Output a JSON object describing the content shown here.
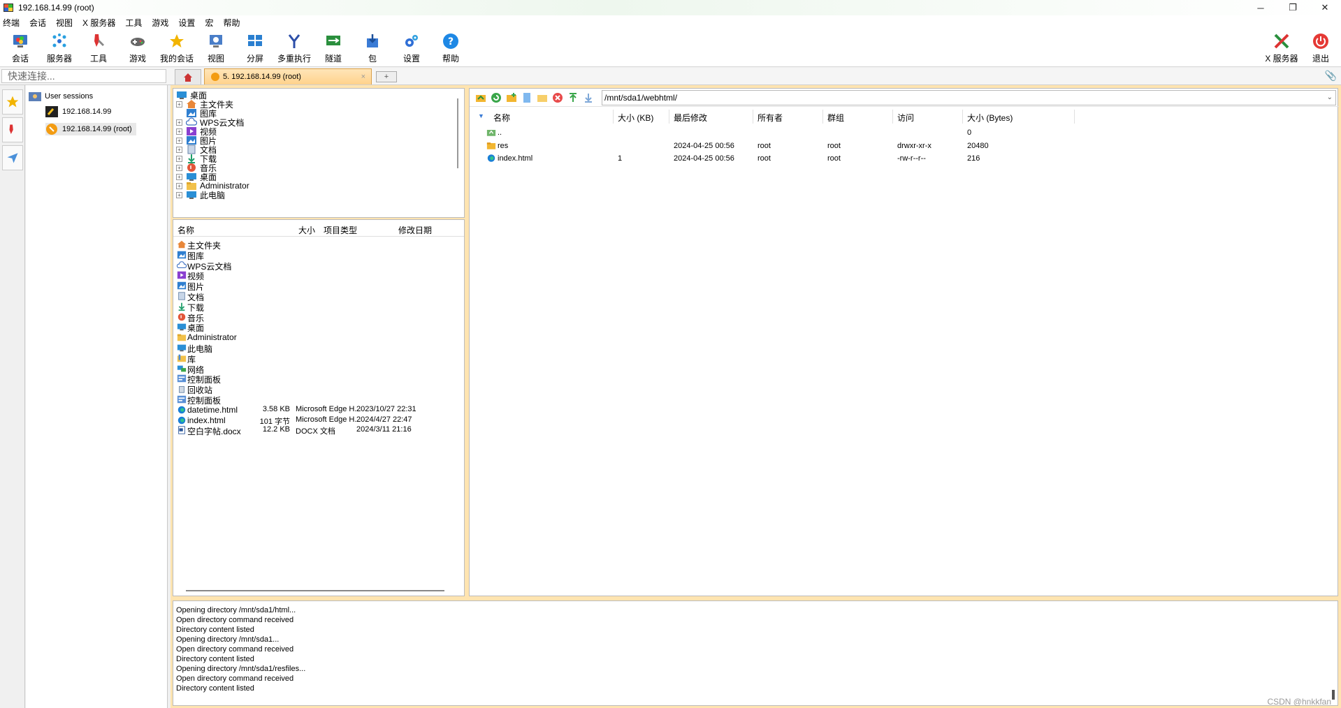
{
  "window": {
    "title": "192.168.14.99 (root)",
    "controls": [
      "─",
      "❐",
      "✕"
    ]
  },
  "menu": [
    "终端",
    "会话",
    "视图",
    "X 服务器",
    "工具",
    "游戏",
    "设置",
    "宏",
    "帮助"
  ],
  "toolbar": {
    "session": "会话",
    "servers": "服务器",
    "tools": "工具",
    "games": "游戏",
    "my_sessions": "我的会话",
    "view": "视图",
    "split": "分屏",
    "multiexec": "多重执行",
    "tunnel": "隧道",
    "packages": "包",
    "settings": "设置",
    "help": "帮助",
    "xserver": "X 服务器",
    "exit": "退出"
  },
  "quick_connect": {
    "placeholder": "快速连接..."
  },
  "tabs": {
    "active": "5. 192.168.14.99 (root)",
    "close": "×",
    "add": "+"
  },
  "sessions": {
    "root": "User sessions",
    "items": [
      "192.168.14.99",
      "192.168.14.99 (root)"
    ]
  },
  "local_tree": [
    {
      "label": "桌面",
      "pm": ""
    },
    {
      "label": "主文件夹",
      "pm": "+"
    },
    {
      "label": "图库",
      "pm": ""
    },
    {
      "label": "WPS云文档",
      "pm": "+"
    },
    {
      "label": "视频",
      "pm": "+"
    },
    {
      "label": "图片",
      "pm": "+"
    },
    {
      "label": "文档",
      "pm": "+"
    },
    {
      "label": "下载",
      "pm": "+"
    },
    {
      "label": "音乐",
      "pm": "+"
    },
    {
      "label": "桌面",
      "pm": "+"
    },
    {
      "label": "Administrator",
      "pm": "+"
    },
    {
      "label": "此电脑",
      "pm": "+"
    }
  ],
  "local_list": {
    "headers": {
      "name": "名称",
      "size": "大小",
      "type": "项目类型",
      "date": "修改日期"
    },
    "rows": [
      {
        "name": "主文件夹",
        "size": "",
        "type": "",
        "date": ""
      },
      {
        "name": "图库",
        "size": "",
        "type": "",
        "date": ""
      },
      {
        "name": "WPS云文档",
        "size": "",
        "type": "",
        "date": ""
      },
      {
        "name": "视频",
        "size": "",
        "type": "",
        "date": ""
      },
      {
        "name": "图片",
        "size": "",
        "type": "",
        "date": ""
      },
      {
        "name": "文档",
        "size": "",
        "type": "",
        "date": ""
      },
      {
        "name": "下载",
        "size": "",
        "type": "",
        "date": ""
      },
      {
        "name": "音乐",
        "size": "",
        "type": "",
        "date": ""
      },
      {
        "name": "桌面",
        "size": "",
        "type": "",
        "date": ""
      },
      {
        "name": "Administrator",
        "size": "",
        "type": "",
        "date": ""
      },
      {
        "name": "此电脑",
        "size": "",
        "type": "",
        "date": ""
      },
      {
        "name": "库",
        "size": "",
        "type": "",
        "date": ""
      },
      {
        "name": "网络",
        "size": "",
        "type": "",
        "date": ""
      },
      {
        "name": "控制面板",
        "size": "",
        "type": "",
        "date": ""
      },
      {
        "name": "回收站",
        "size": "",
        "type": "",
        "date": ""
      },
      {
        "name": "控制面板",
        "size": "",
        "type": "",
        "date": ""
      },
      {
        "name": "datetime.html",
        "size": "3.58 KB",
        "type": "Microsoft Edge H...",
        "date": "2023/10/27 22:31"
      },
      {
        "name": "index.html",
        "size": "101 字节",
        "type": "Microsoft Edge H...",
        "date": "2024/4/27 22:47"
      },
      {
        "name": "空白字帖.docx",
        "size": "12.2 KB",
        "type": "DOCX 文档",
        "date": "2024/3/11 21:16"
      }
    ]
  },
  "remote": {
    "path": "/mnt/sda1/webhtml/",
    "headers": {
      "name": "名称",
      "size_kb": "大小 (KB)",
      "modified": "最后修改",
      "owner": "所有者",
      "group": "群组",
      "access": "访问",
      "size_bytes": "大小 (Bytes)"
    },
    "rows": [
      {
        "name": "..",
        "size_kb": "",
        "modified": "",
        "owner": "",
        "group": "",
        "access": "",
        "size_bytes": "0"
      },
      {
        "name": "res",
        "size_kb": "",
        "modified": "2024-04-25 00:56",
        "owner": "root",
        "group": "root",
        "access": "drwxr-xr-x",
        "size_bytes": "20480"
      },
      {
        "name": "index.html",
        "size_kb": "1",
        "modified": "2024-04-25 00:56",
        "owner": "root",
        "group": "root",
        "access": "-rw-r--r--",
        "size_bytes": "216"
      }
    ]
  },
  "log": [
    "Opening directory /mnt/sda1/html...",
    "Open directory command received",
    "Directory content listed",
    "Opening directory /mnt/sda1...",
    "Open directory command received",
    "Directory content listed",
    "Opening directory /mnt/sda1/resfiles...",
    "Open directory command received",
    "Directory content listed"
  ],
  "watermark": "CSDN @hnkkfan"
}
